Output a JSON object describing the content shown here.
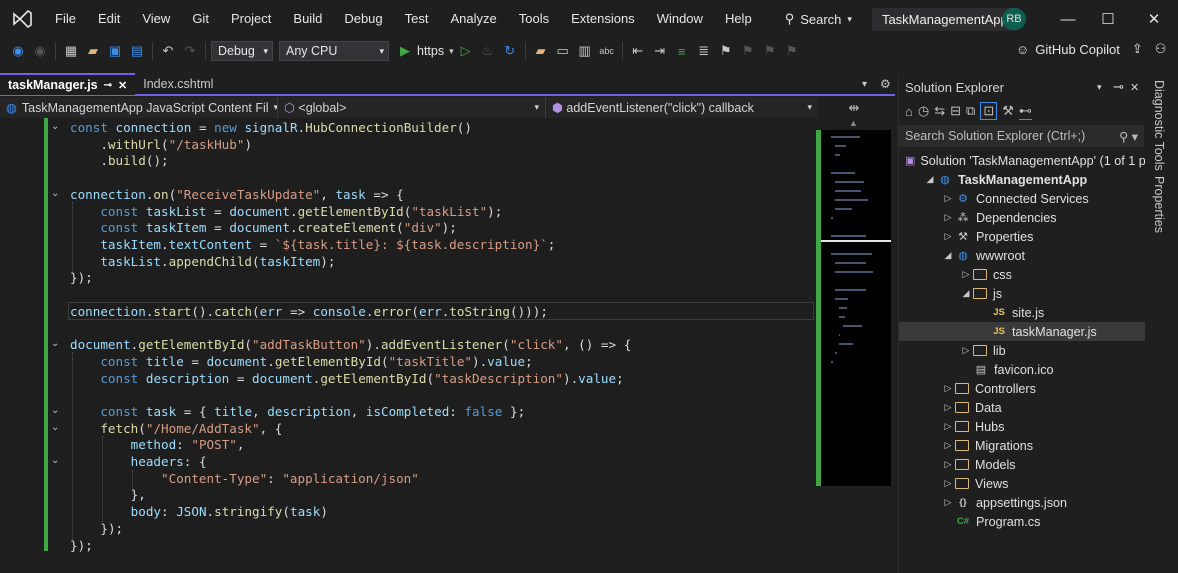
{
  "menu": [
    "File",
    "Edit",
    "View",
    "Git",
    "Project",
    "Build",
    "Debug",
    "Test",
    "Analyze",
    "Tools",
    "Extensions",
    "Window",
    "Help"
  ],
  "search_label": "Search",
  "app_title": "TaskManagementApp",
  "user_initials": "RB",
  "toolbar": {
    "config": "Debug",
    "platform": "Any CPU",
    "run_target": "https",
    "copilot": "GitHub Copilot"
  },
  "tabs": [
    {
      "label": "taskManager.js",
      "active": true
    },
    {
      "label": "Index.cshtml",
      "active": false
    }
  ],
  "navbar": {
    "project": "TaskManagementApp JavaScript Content Fil",
    "scope": "<global>",
    "member": "addEventListener(\"click\") callback"
  },
  "code": [
    "const connection = new signalR.HubConnectionBuilder()",
    "    .withUrl(\"/taskHub\")",
    "    .build();",
    "",
    "connection.on(\"ReceiveTaskUpdate\", task => {",
    "    const taskList = document.getElementById(\"taskList\");",
    "    const taskItem = document.createElement(\"div\");",
    "    taskItem.textContent = `${task.title}: ${task.description}`;",
    "    taskList.appendChild(taskItem);",
    "});",
    "",
    "connection.start().catch(err => console.error(err.toString()));",
    "",
    "document.getElementById(\"addTaskButton\").addEventListener(\"click\", () => {",
    "    const title = document.getElementById(\"taskTitle\").value;",
    "    const description = document.getElementById(\"taskDescription\").value;",
    "",
    "    const task = { title, description, isCompleted: false };",
    "    fetch(\"/Home/AddTask\", {",
    "        method: \"POST\",",
    "        headers: {",
    "            \"Content-Type\": \"application/json\"",
    "        },",
    "        body: JSON.stringify(task)",
    "    });",
    "});"
  ],
  "solution_explorer": {
    "title": "Solution Explorer",
    "search_placeholder": "Search Solution Explorer (Ctrl+;)",
    "items": [
      {
        "label": "Solution 'TaskManagementApp' (1 of 1 p",
        "icon": "solution-icon",
        "depth": 0,
        "expander": ""
      },
      {
        "label": "TaskManagementApp",
        "icon": "web-project-icon",
        "depth": 1,
        "expander": "open",
        "bold": true
      },
      {
        "label": "Connected Services",
        "icon": "connected-services-icon",
        "depth": 2,
        "expander": "closed"
      },
      {
        "label": "Dependencies",
        "icon": "dependencies-icon",
        "depth": 2,
        "expander": "closed"
      },
      {
        "label": "Properties",
        "icon": "wrench-icon",
        "depth": 2,
        "expander": "closed"
      },
      {
        "label": "wwwroot",
        "icon": "globe-icon",
        "depth": 2,
        "expander": "open"
      },
      {
        "label": "css",
        "icon": "folder-icon",
        "depth": 3,
        "expander": "closed"
      },
      {
        "label": "js",
        "icon": "folder-icon",
        "depth": 3,
        "expander": "open"
      },
      {
        "label": "site.js",
        "icon": "js-file-icon",
        "depth": 4,
        "expander": ""
      },
      {
        "label": "taskManager.js",
        "icon": "js-file-icon",
        "depth": 4,
        "expander": "",
        "selected": true
      },
      {
        "label": "lib",
        "icon": "folder-icon",
        "depth": 3,
        "expander": "closed"
      },
      {
        "label": "favicon.ico",
        "icon": "image-file-icon",
        "depth": 3,
        "expander": ""
      },
      {
        "label": "Controllers",
        "icon": "folder-icon",
        "depth": 2,
        "expander": "closed"
      },
      {
        "label": "Data",
        "icon": "folder-icon",
        "depth": 2,
        "expander": "closed"
      },
      {
        "label": "Hubs",
        "icon": "folder-icon",
        "depth": 2,
        "expander": "closed"
      },
      {
        "label": "Migrations",
        "icon": "folder-icon",
        "depth": 2,
        "expander": "closed"
      },
      {
        "label": "Models",
        "icon": "folder-icon",
        "depth": 2,
        "expander": "closed"
      },
      {
        "label": "Views",
        "icon": "folder-icon",
        "depth": 2,
        "expander": "closed"
      },
      {
        "label": "appsettings.json",
        "icon": "json-file-icon",
        "depth": 2,
        "expander": "closed"
      },
      {
        "label": "Program.cs",
        "icon": "csharp-file-icon",
        "depth": 2,
        "expander": ""
      }
    ]
  },
  "side_tabs": [
    "Diagnostic Tools",
    "Properties"
  ],
  "colors": {
    "accent": "#7160e8",
    "changed_gutter": "#3fa845",
    "keyword": "#569cd6",
    "string": "#d69d85"
  }
}
